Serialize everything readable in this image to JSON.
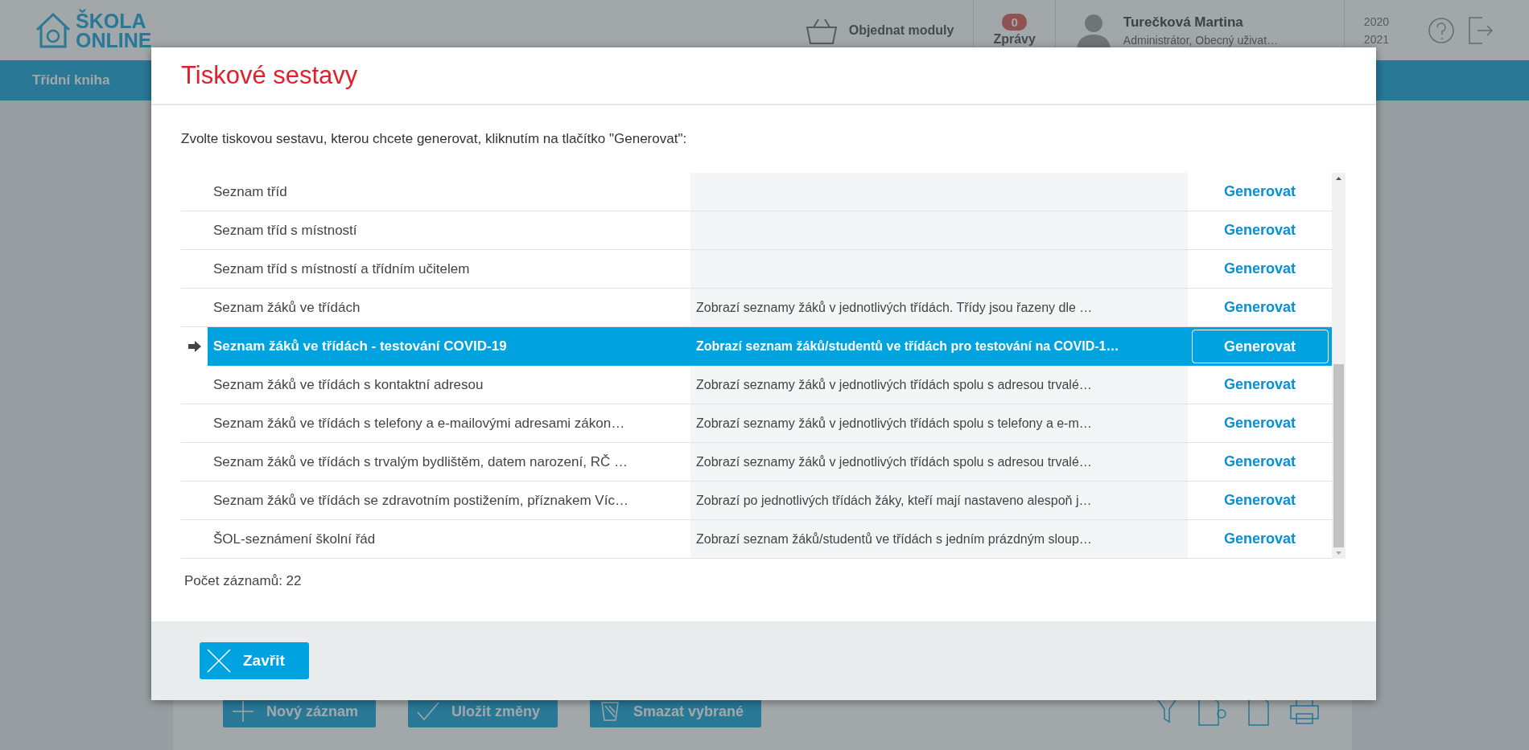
{
  "header": {
    "logo_lines": [
      "ŠKOLA",
      "ONLINE"
    ],
    "order_modules": "Objednat moduly",
    "messages": {
      "count": "0",
      "label": "Zprávy"
    },
    "user": {
      "name": "Turečková Martina",
      "role": "Administrátor, Obecný uživat…"
    },
    "years": [
      "2020",
      "2021"
    ]
  },
  "nav": {
    "items": [
      "Třídní kniha"
    ]
  },
  "toolbar": {
    "buttons": [
      {
        "kind": "add",
        "label": "Nový záznam"
      },
      {
        "kind": "save",
        "label": "Uložit změny"
      },
      {
        "kind": "delete",
        "label": "Smazat vybrané"
      }
    ]
  },
  "dialog": {
    "title": "Tiskové sestavy",
    "instruction": "Zvolte tiskovou sestavu, kterou chcete generovat, kliknutím na tlačítko \"Generovat\":",
    "rows": [
      {
        "name": "Seznam tříd",
        "description": "",
        "action": "Generovat",
        "selected": false
      },
      {
        "name": "Seznam tříd s místností",
        "description": "",
        "action": "Generovat",
        "selected": false
      },
      {
        "name": "Seznam tříd s místností a třídním učitelem",
        "description": "",
        "action": "Generovat",
        "selected": false
      },
      {
        "name": "Seznam žáků ve třídách",
        "description": "Zobrazí seznamy žáků v jednotlivých třídách. Třídy jsou řazeny dle …",
        "action": "Generovat",
        "selected": false
      },
      {
        "name": "Seznam žáků ve třídách - testování COVID-19",
        "description": "Zobrazí seznam žáků/studentů ve třídách pro testování na COVID-1…",
        "action": "Generovat",
        "selected": true
      },
      {
        "name": "Seznam žáků ve třídách s kontaktní adresou",
        "description": "Zobrazí seznamy žáků v jednotlivých třídách spolu s adresou trvalé…",
        "action": "Generovat",
        "selected": false
      },
      {
        "name": "Seznam žáků ve třídách s telefony a e-mailovými adresami zákon…",
        "description": "Zobrazí seznamy žáků v jednotlivých třídách spolu s telefony a e-m…",
        "action": "Generovat",
        "selected": false
      },
      {
        "name": "Seznam žáků ve třídách s trvalým bydlištěm, datem narození, RČ …",
        "description": "Zobrazí seznamy žáků v jednotlivých třídách spolu s adresou trvalé…",
        "action": "Generovat",
        "selected": false
      },
      {
        "name": "Seznam žáků ve třídách se zdravotním postižením, příznakem Víc…",
        "description": "Zobrazí po jednotlivých třídách žáky, kteří mají nastaveno alespoň j…",
        "action": "Generovat",
        "selected": false
      },
      {
        "name": "ŠOL-seznámení školní řád",
        "description": "Zobrazí seznam žáků/studentů ve třídách s jedním prázdným sloup…",
        "action": "Generovat",
        "selected": false
      }
    ],
    "record_count": "Počet záznamů: 22",
    "close": "Zavřit"
  }
}
